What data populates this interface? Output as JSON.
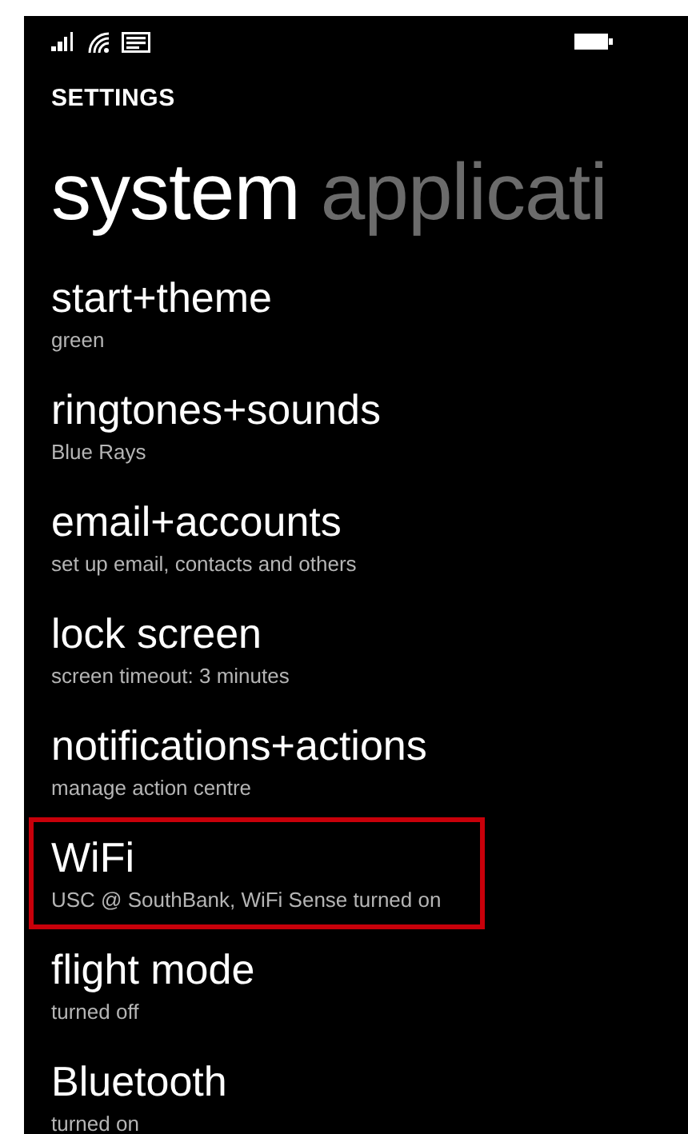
{
  "header": "SETTINGS",
  "pivots": [
    {
      "label": "system",
      "selected": true
    },
    {
      "label": "applicati",
      "selected": false
    }
  ],
  "items": [
    {
      "title": "start+theme",
      "subtitle": "green",
      "highlighted": false
    },
    {
      "title": "ringtones+sounds",
      "subtitle": "Blue Rays",
      "highlighted": false
    },
    {
      "title": "email+accounts",
      "subtitle": "set up email, contacts and others",
      "highlighted": false
    },
    {
      "title": "lock screen",
      "subtitle": "screen timeout: 3 minutes",
      "highlighted": false
    },
    {
      "title": "notifications+actions",
      "subtitle": "manage action centre",
      "highlighted": false
    },
    {
      "title": "WiFi",
      "subtitle": "USC @ SouthBank, WiFi Sense turned on",
      "highlighted": true
    },
    {
      "title": "flight mode",
      "subtitle": "turned off",
      "highlighted": false
    },
    {
      "title": "Bluetooth",
      "subtitle": "turned on",
      "highlighted": false
    }
  ]
}
